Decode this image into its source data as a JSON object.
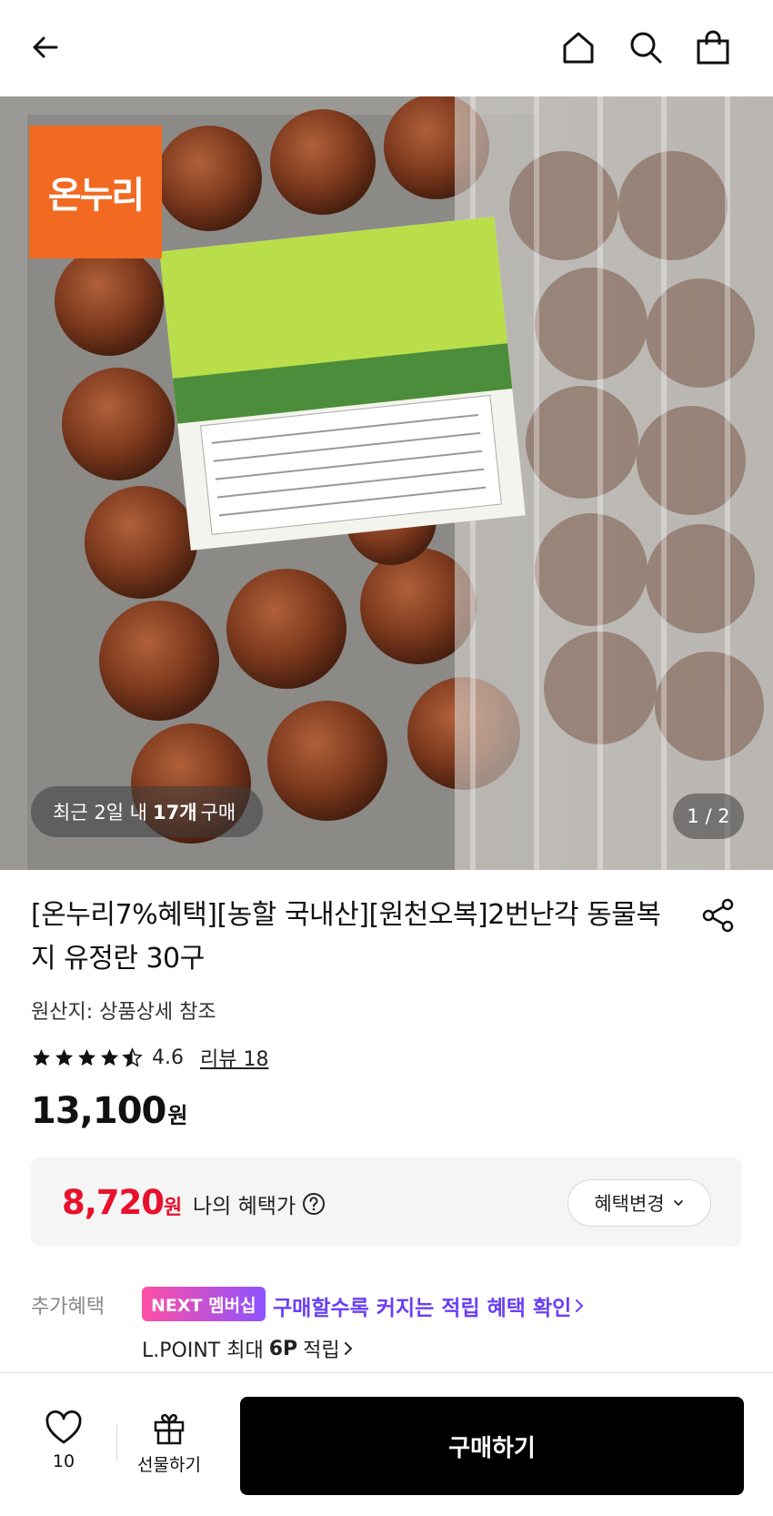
{
  "header": {
    "back_icon": "arrow-left-icon",
    "home_icon": "home-icon",
    "search_icon": "search-icon",
    "bag_icon": "shopping-bag-icon"
  },
  "hero": {
    "brand_badge": "온누리",
    "recent_prefix": "최근 2일 내",
    "recent_count": "17개",
    "recent_suffix": "구매",
    "page_indicator": "1 / 2",
    "brand_color": "#f26a22"
  },
  "product": {
    "title": "[온누리7%혜택][농할 국내산][원천오복]2번난각 동물복지 유정란 30구",
    "origin": "원산지: 상품상세 참조",
    "rating": "4.6",
    "rating_value": 4.6,
    "reviews": "리뷰 18",
    "price": "13,100",
    "price_unit": "원"
  },
  "benefit": {
    "price": "8,720",
    "price_unit": "원",
    "label": "나의 혜택가",
    "change_button": "혜택변경",
    "accent_color": "#e8112d"
  },
  "extra": {
    "label": "추가혜택",
    "next_badge": "NEXT 멤버십",
    "next_text": "구매할수록 커지는 적립 혜택 확인",
    "lpoint_prefix": "L.POINT 최대",
    "lpoint_amount": "6P",
    "lpoint_suffix": "적립"
  },
  "bottom": {
    "like_count": "10",
    "gift_label": "선물하기",
    "buy_label": "구매하기"
  }
}
